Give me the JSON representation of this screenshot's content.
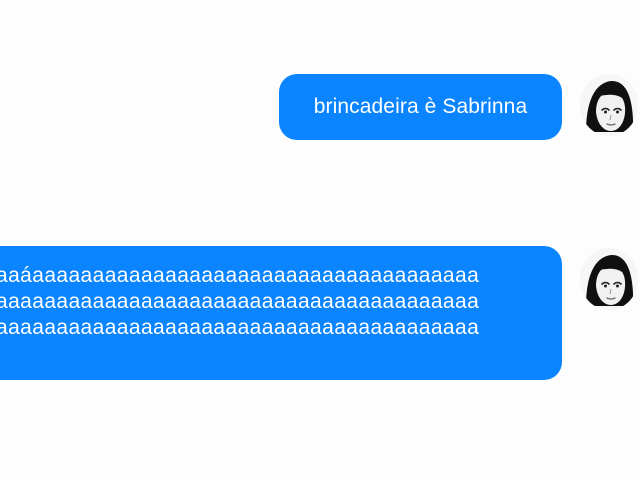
{
  "chat": {
    "messages": [
      {
        "text": "brincadeira è Sabrinna",
        "sender": "self",
        "avatar_icon": "user-avatar-icon"
      },
      {
        "text": "aaáaaaaaaaaaaaaaaaaaaaaaaaaaaaaaaaaaaaaa\naaaaaaaaaaaaaaaaaaaaaaaaaaaaaaaaaaaaaaaa\naaaaaaaaaaaaaaaaaaaaaaaaaaaaaaaaaaaaaaaa",
        "sender": "self",
        "avatar_icon": "user-avatar-icon"
      }
    ]
  },
  "colors": {
    "background": "#fdfdfd",
    "bubble": "#0a84ff",
    "bubble_text": "#ffffff"
  }
}
